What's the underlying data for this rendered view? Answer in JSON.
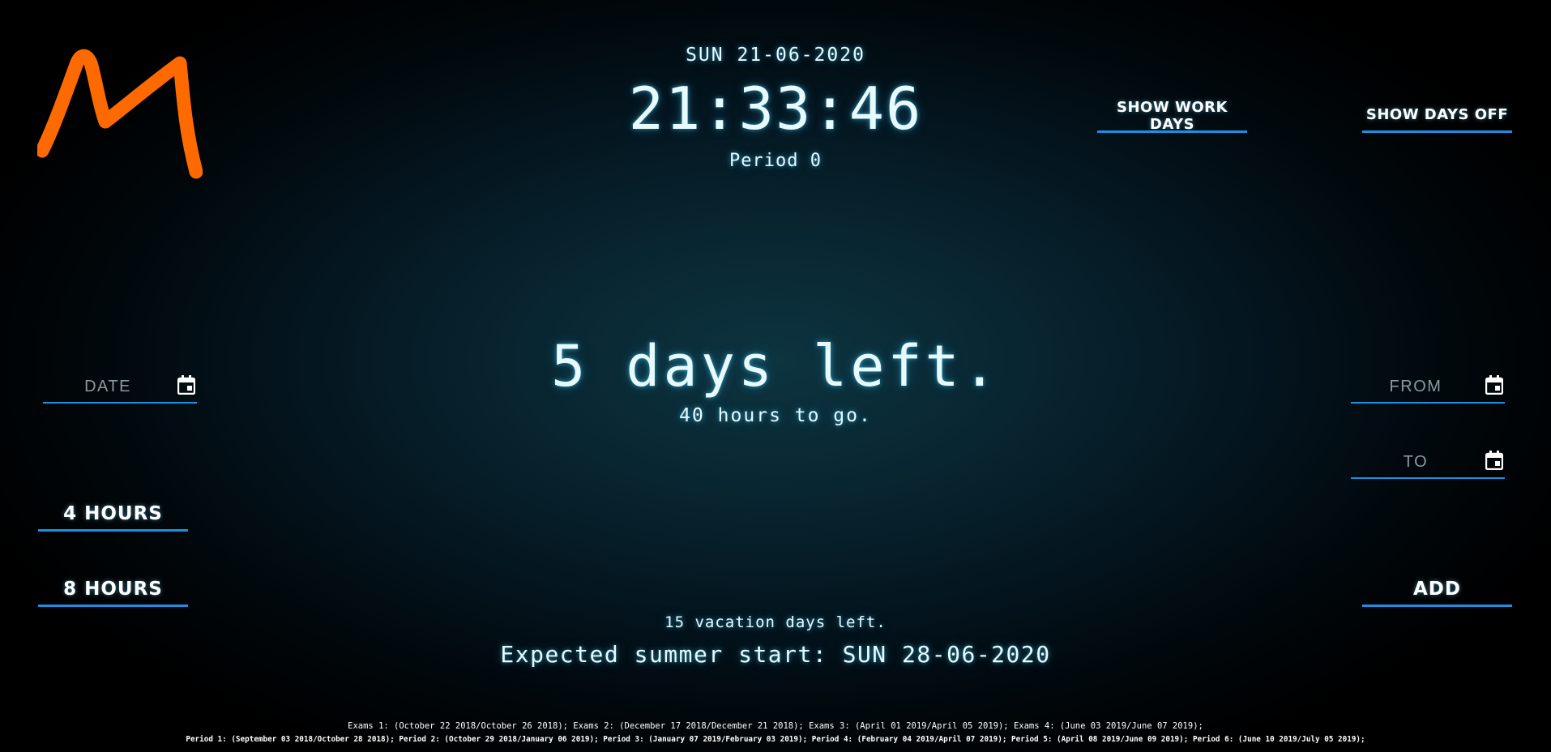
{
  "header": {
    "date": "SUN 21-06-2020",
    "time": "21:33:46",
    "period": "Period 0"
  },
  "buttons": {
    "show_work_days": "SHOW WORK DAYS",
    "show_days_off": "SHOW DAYS OFF",
    "four_hours": "4 HOURS",
    "eight_hours": "8 HOURS",
    "add": "ADD"
  },
  "inputs": {
    "date_placeholder": "DATE",
    "from_placeholder": "FROM",
    "to_placeholder": "TO"
  },
  "main": {
    "days_left": "5 days left.",
    "hours_left": "40 hours to go.",
    "vacation_days_left": "15 vacation days left.",
    "expected_summer": "Expected summer start: SUN 28-06-2020"
  },
  "footer": {
    "exams": "Exams 1: (October 22 2018/October 26 2018); Exams 2: (December 17 2018/December 21 2018); Exams 3: (April 01 2019/April 05 2019); Exams 4: (June 03 2019/June 07 2019);",
    "periods": "Period 1: (September 03 2018/October 28 2018); Period 2: (October 29 2018/January 06 2019); Period 3: (January 07 2019/February 03 2019); Period 4: (February 04 2019/April 07 2019); Period 5: (April 08 2019/June 09 2019); Period 6: (June 10 2019/July 05 2019);"
  },
  "icons": {
    "logo": "m-logo",
    "calendar": "calendar-icon"
  },
  "colors": {
    "accent": "#1c8fe0",
    "logo": "#ff6a00",
    "text": "#e6fbff"
  }
}
